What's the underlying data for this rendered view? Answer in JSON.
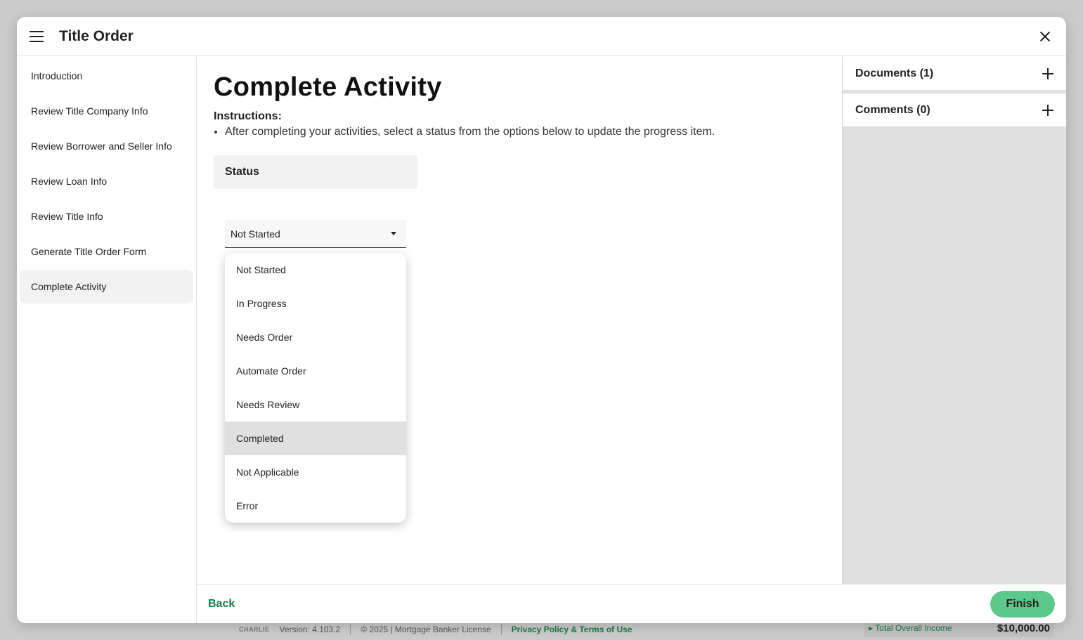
{
  "background": {
    "footer": {
      "logo_text": "CHARLIE",
      "version": "Version: 4.103.2",
      "copyright": "© 2025 | Mortgage Banker License",
      "privacy_link": "Privacy Policy & Terms of Use"
    },
    "income": {
      "label": "Total Overall Income",
      "value": "$10,000.00"
    }
  },
  "modal": {
    "title": "Title Order"
  },
  "sidebar": {
    "items": [
      {
        "label": "Introduction"
      },
      {
        "label": "Review Title Company Info"
      },
      {
        "label": "Review Borrower and Seller Info"
      },
      {
        "label": "Review Loan Info"
      },
      {
        "label": "Review Title Info"
      },
      {
        "label": "Generate Title Order Form"
      },
      {
        "label": "Complete Activity"
      }
    ],
    "active_index": 6
  },
  "main": {
    "title": "Complete Activity",
    "instructions_label": "Instructions:",
    "instructions": [
      "After completing your activities, select a status from the options below to update the progress item."
    ],
    "status_label": "Status",
    "status_select": {
      "value": "Not Started",
      "options": [
        "Not Started",
        "In Progress",
        "Needs Order",
        "Automate Order",
        "Needs Review",
        "Completed",
        "Not Applicable",
        "Error"
      ],
      "highlighted": "Completed"
    }
  },
  "right_panel": {
    "documents_label": "Documents (1)",
    "comments_label": "Comments (0)"
  },
  "footer": {
    "back_label": "Back",
    "finish_label": "Finish"
  },
  "colors": {
    "accent_green": "#5cc98a",
    "link_green": "#1a7a46"
  }
}
